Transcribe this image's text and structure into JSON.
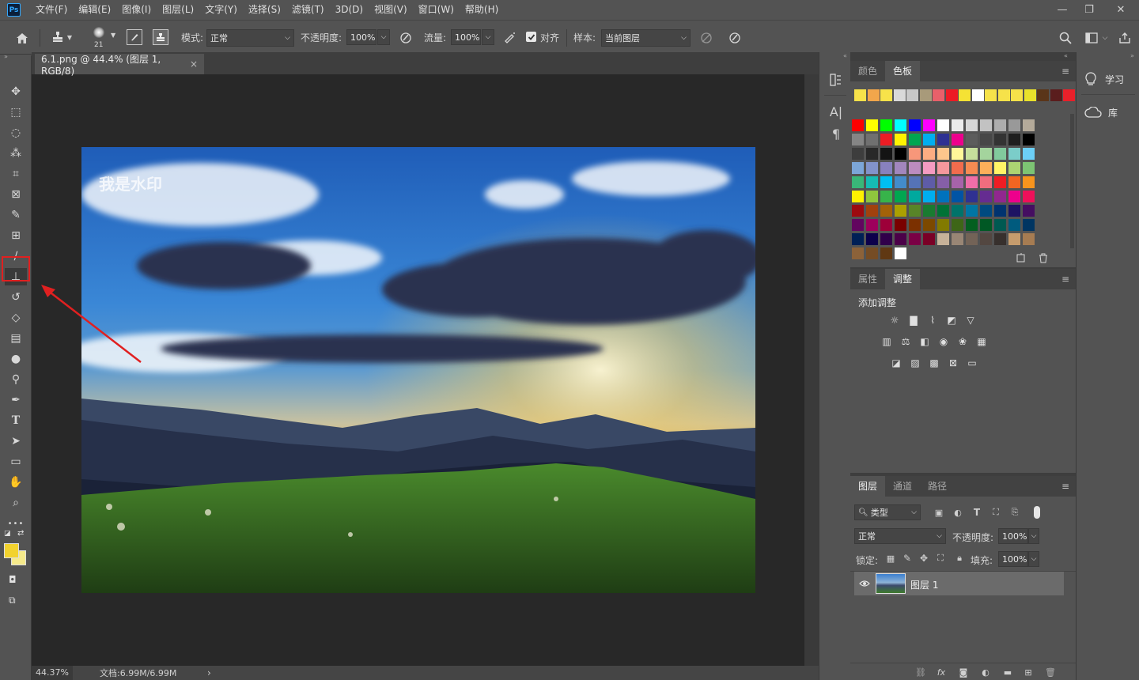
{
  "app": {
    "logo": "Ps",
    "accent": "#31a8ff"
  },
  "menu": [
    "文件(F)",
    "编辑(E)",
    "图像(I)",
    "图层(L)",
    "文字(Y)",
    "选择(S)",
    "滤镜(T)",
    "3D(D)",
    "视图(V)",
    "窗口(W)",
    "帮助(H)"
  ],
  "window_controls": {
    "minimize": "—",
    "restore": "❐",
    "close": "✕"
  },
  "options": {
    "brush_size": "21",
    "mode_label": "模式:",
    "mode_value": "正常",
    "opacity_label": "不透明度:",
    "opacity_value": "100%",
    "flow_label": "流量:",
    "flow_value": "100%",
    "aligned_label": "对齐",
    "aligned_checked": true,
    "sample_label": "样本:",
    "sample_value": "当前图层"
  },
  "document": {
    "tab_title": "6.1.png @ 44.4% (图层 1, RGB/8)",
    "tab_close": "×",
    "watermark": "我是水印",
    "zoom": "44.37%",
    "doc_size": "文档:6.99M/6.99M",
    "status_arrow": "›"
  },
  "tools": [
    "move-tool",
    "marquee-tool",
    "lasso-tool",
    "magic-wand-tool",
    "crop-tool",
    "frame-tool",
    "eyedropper-tool",
    "healing-brush-tool",
    "brush-tool",
    "clone-stamp-tool",
    "history-brush-tool",
    "eraser-tool",
    "gradient-tool",
    "blur-tool",
    "dodge-tool",
    "pen-tool",
    "type-tool",
    "path-selection-tool",
    "rectangle-tool",
    "hand-tool",
    "zoom-tool",
    "more-tools"
  ],
  "active_tool": "clone-stamp-tool",
  "highlight_color": "#e02020",
  "colors": {
    "foreground": "#f2d22e",
    "background": "#f5e98a"
  },
  "swatches_panel": {
    "tabs": [
      "颜色",
      "色板"
    ],
    "active": 1,
    "recent": [
      "#f7e24a",
      "#f2a64b",
      "#f7e24a",
      "#d9d9d9",
      "#c8c8c8",
      "#a89a7a",
      "#e8606a",
      "#ec1c24",
      "#f5e234",
      "#ffffff",
      "#f6e24a",
      "#f6e24a",
      "#f6e24a",
      "#e9e22b",
      "#5a3519",
      "#5a1d1d",
      "#e8202a"
    ],
    "grid": [
      [
        "#ff0000",
        "#ffff00",
        "#00ff00",
        "#00ffff",
        "#0000ff",
        "#ff00ff",
        "#ffffff",
        "#ebebeb",
        "#d6d6d6",
        "#c2c2c2",
        "#adadad",
        "#999999",
        "#b4aa9a"
      ],
      [
        "#858585",
        "#707070",
        "#ec1c24",
        "#fff200",
        "#00a651",
        "#00aeef",
        "#2e3192",
        "#ec008c",
        "#5c5c5c",
        "#474747",
        "#333333",
        "#1f1f1f",
        "#000000"
      ],
      [
        "#3d3d3d",
        "#282828",
        "#141414",
        "#000000",
        "#f7977a",
        "#fbad82",
        "#fdc68c",
        "#fff799",
        "#c6df9c",
        "#a4d49d",
        "#81ca9d",
        "#7bcdc9",
        "#6ccff7"
      ],
      [
        "#7ca6d8",
        "#8293ca",
        "#8881be",
        "#a286bd",
        "#bc8cbf",
        "#f49bc1",
        "#f5989d",
        "#f16c4d",
        "#f68b52",
        "#fbaf5a",
        "#fff467",
        "#acd372",
        "#7dc473"
      ],
      [
        "#39b778",
        "#16bcb4",
        "#00bff3",
        "#438ccb",
        "#5573b7",
        "#5e5ca7",
        "#855fa8",
        "#a763a9",
        "#ef6ea8",
        "#f16d7e",
        "#ee1d24",
        "#f16522",
        "#f7941d"
      ],
      [
        "#fff100",
        "#8fc63d",
        "#37b44a",
        "#00a650",
        "#00a99e",
        "#00aeef",
        "#0072bc",
        "#0054a5",
        "#2f3192",
        "#652c91",
        "#91278f",
        "#ed008c",
        "#ee105a"
      ],
      [
        "#9d0a0f",
        "#a1410d",
        "#a36209",
        "#aba000",
        "#588528",
        "#197b30",
        "#007236",
        "#00736a",
        "#0076a4",
        "#004a80",
        "#003370",
        "#1d1363",
        "#450e61"
      ],
      [
        "#62055f",
        "#9e005c",
        "#9d0039",
        "#790000",
        "#7b3000",
        "#7c4900",
        "#827a00",
        "#3e6617",
        "#045f20",
        "#005824",
        "#005951",
        "#005b7e",
        "#003562"
      ],
      [
        "#002056",
        "#0c004b",
        "#30004a",
        "#4b0048",
        "#7a0045",
        "#7a0026",
        "#c7b299",
        "#998675",
        "#736357",
        "#534741",
        "#37302d",
        "#c69c6d",
        "#a67c52"
      ],
      [
        "#8c6239",
        "#754c24",
        "#603813",
        "#ffffff"
      ]
    ]
  },
  "adjustments_panel": {
    "tabs": [
      "属性",
      "调整"
    ],
    "active": 1,
    "title": "添加调整",
    "icons": [
      [
        "brightness-contrast-icon",
        "levels-icon",
        "curves-icon",
        "exposure-icon",
        "vibrance-icon"
      ],
      [
        "hue-saturation-icon",
        "color-balance-icon",
        "black-white-icon",
        "photo-filter-icon",
        "channel-mixer-icon",
        "color-lookup-icon"
      ],
      [
        "invert-icon",
        "posterize-icon",
        "threshold-icon",
        "selective-color-icon",
        "gradient-map-icon"
      ]
    ]
  },
  "layers_panel": {
    "tabs": [
      "图层",
      "通道",
      "路径"
    ],
    "active": 0,
    "filter_label": "类型",
    "blend_mode": "正常",
    "opacity_label": "不透明度:",
    "opacity_value": "100%",
    "lock_label": "锁定:",
    "fill_label": "填充:",
    "fill_value": "100%",
    "layers": [
      {
        "name": "图层 1",
        "visible": true
      }
    ]
  },
  "side_panels": {
    "learn": "学习",
    "libraries": "库"
  }
}
